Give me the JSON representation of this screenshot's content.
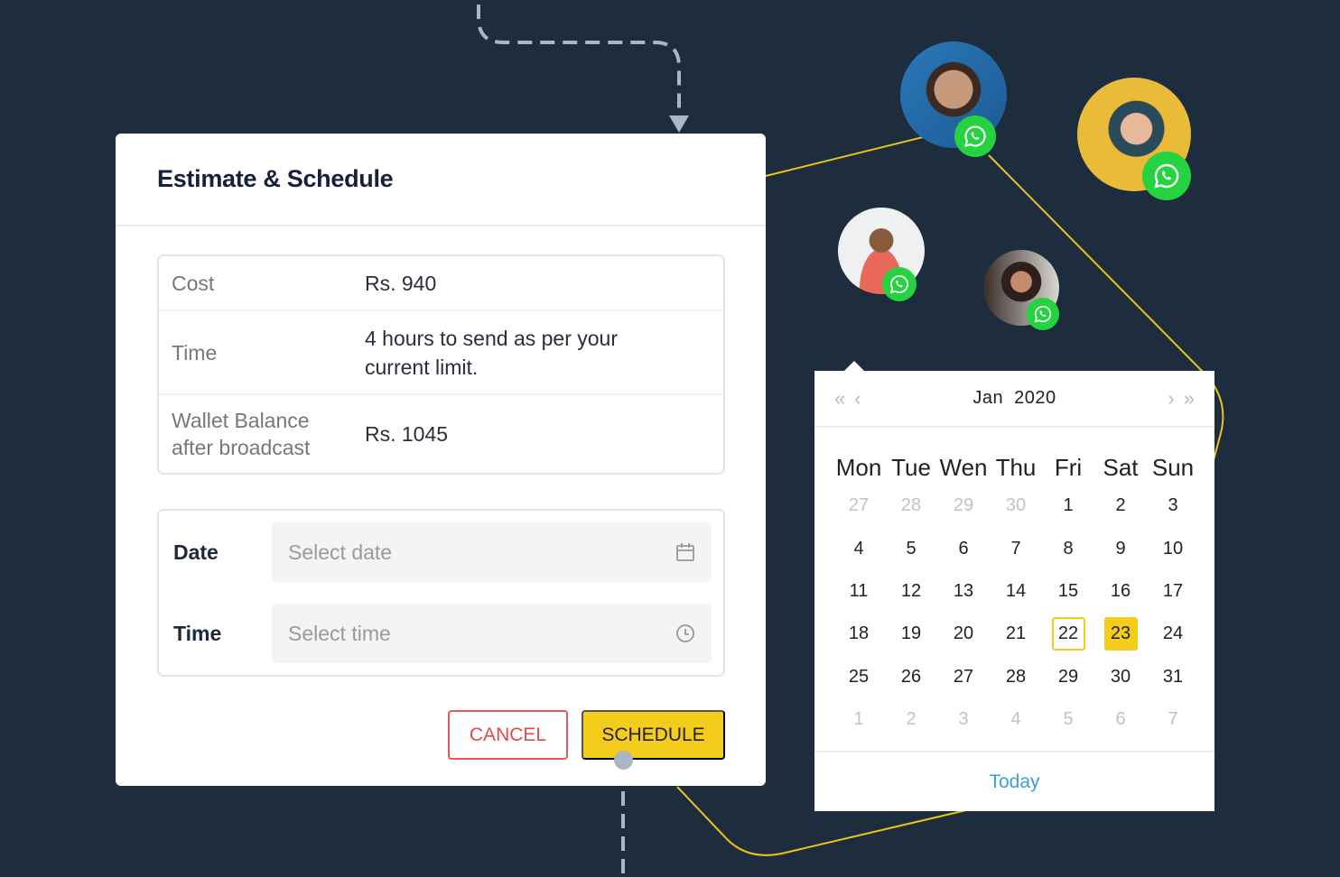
{
  "colors": {
    "background": "#1e2d3e",
    "accent_yellow": "#f4cc1b",
    "cancel_red": "#e04a4a",
    "whatsapp_green": "#25d340",
    "link_blue": "#3a9fd6",
    "connector_gray": "#aab6c3"
  },
  "modal": {
    "title": "Estimate & Schedule",
    "estimate": [
      {
        "label": "Cost",
        "value": "Rs. 940"
      },
      {
        "label": "Time",
        "value": "4 hours to send as per your current limit."
      },
      {
        "label": "Wallet Balance after broadcast",
        "value": "Rs. 1045"
      }
    ],
    "date_field": {
      "label": "Date",
      "placeholder": "Select date",
      "icon": "calendar-icon"
    },
    "time_field": {
      "label": "Time",
      "placeholder": "Select time",
      "icon": "clock-icon"
    },
    "cancel_label": "CANCEL",
    "schedule_label": "SCHEDULE"
  },
  "contacts": [
    {
      "name": "contact-1",
      "badge_icon": "whatsapp-icon"
    },
    {
      "name": "contact-2",
      "badge_icon": "whatsapp-icon"
    },
    {
      "name": "contact-3",
      "badge_icon": "whatsapp-icon"
    },
    {
      "name": "contact-4",
      "badge_icon": "whatsapp-icon"
    }
  ],
  "calendar": {
    "month_label": "Jan 2020",
    "nav": {
      "prev_year": "«",
      "prev_month": "‹",
      "next_month": "›",
      "next_year": "»"
    },
    "weekdays": [
      "Mon",
      "Tue",
      "Wen",
      "Thu",
      "Fri",
      "Sat",
      "Sun"
    ],
    "days": [
      {
        "d": "27",
        "muted": true
      },
      {
        "d": "28",
        "muted": true
      },
      {
        "d": "29",
        "muted": true
      },
      {
        "d": "30",
        "muted": true
      },
      {
        "d": "1"
      },
      {
        "d": "2"
      },
      {
        "d": "3"
      },
      {
        "d": "4"
      },
      {
        "d": "5"
      },
      {
        "d": "6"
      },
      {
        "d": "7"
      },
      {
        "d": "8"
      },
      {
        "d": "9"
      },
      {
        "d": "10"
      },
      {
        "d": "11"
      },
      {
        "d": "12"
      },
      {
        "d": "13"
      },
      {
        "d": "14"
      },
      {
        "d": "15"
      },
      {
        "d": "16"
      },
      {
        "d": "17"
      },
      {
        "d": "18"
      },
      {
        "d": "19"
      },
      {
        "d": "20"
      },
      {
        "d": "21"
      },
      {
        "d": "22",
        "today": true
      },
      {
        "d": "23",
        "selected": true
      },
      {
        "d": "24"
      },
      {
        "d": "25"
      },
      {
        "d": "26"
      },
      {
        "d": "27"
      },
      {
        "d": "28"
      },
      {
        "d": "29"
      },
      {
        "d": "30"
      },
      {
        "d": "31"
      },
      {
        "d": "1",
        "muted": true
      },
      {
        "d": "2",
        "muted": true
      },
      {
        "d": "3",
        "muted": true
      },
      {
        "d": "4",
        "muted": true
      },
      {
        "d": "5",
        "muted": true
      },
      {
        "d": "6",
        "muted": true
      },
      {
        "d": "7",
        "muted": true
      }
    ],
    "today_label": "Today"
  }
}
